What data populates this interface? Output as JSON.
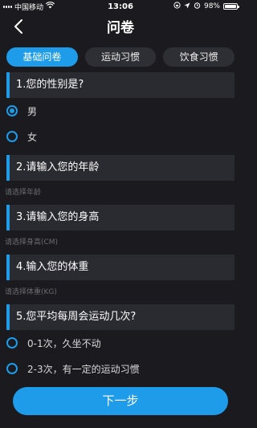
{
  "status_bar": {
    "carrier": "中国移动",
    "time": "13:06",
    "battery": "98%",
    "battery_level": 0.98
  },
  "nav": {
    "title": "问卷"
  },
  "tabs": [
    {
      "label": "基础问卷",
      "active": true
    },
    {
      "label": "运动习惯",
      "active": false
    },
    {
      "label": "饮食习惯",
      "active": false
    }
  ],
  "questions": [
    {
      "title": "1.您的性别是?",
      "options": [
        "男",
        "女"
      ],
      "selected": 0
    },
    {
      "title": "2.请输入您的年龄",
      "hint": "请选择年龄"
    },
    {
      "title": "3.请输入您的身高",
      "hint": "请选择身高(CM)"
    },
    {
      "title": "4.输入您的体重",
      "hint": "请选择体重(KG)"
    },
    {
      "title": "5.您平均每周会运动几次?",
      "options": [
        "0-1次，久坐不动",
        "2-3次，有一定的运动习惯"
      ]
    }
  ],
  "footer": {
    "next_label": "下一步"
  }
}
